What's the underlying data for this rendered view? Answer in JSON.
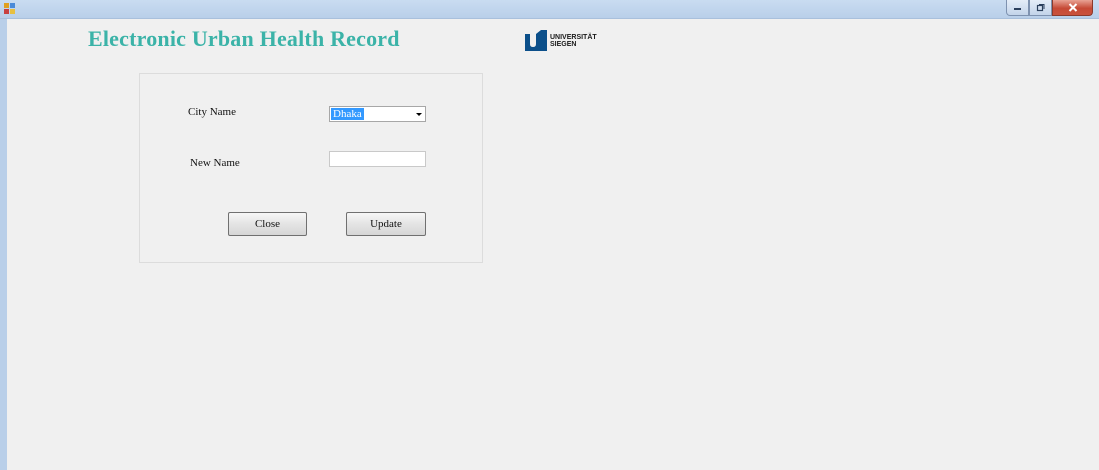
{
  "window": {
    "icon": "app-window-icon",
    "controls": {
      "minimize_icon": "minimize-icon",
      "maximize_icon": "restore-icon",
      "close_icon": "close-icon"
    }
  },
  "header": {
    "title": "Electronic Urban Health Record",
    "title_color": "#3bb3a8",
    "logo": {
      "line1": "UNIVERSITÄT",
      "line2": "SIEGEN",
      "color": "#0b4f8a"
    }
  },
  "form": {
    "city_label": "City Name",
    "city_selected": "Dhaka",
    "new_name_label": "New Name",
    "new_name_value": "",
    "close_label": "Close",
    "update_label": "Update"
  }
}
